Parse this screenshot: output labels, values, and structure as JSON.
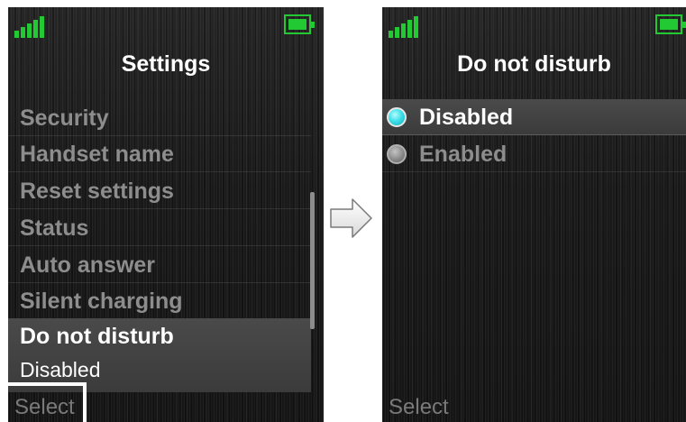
{
  "colors": {
    "signal": "#22c932",
    "battery": "#22c932",
    "radio_selected": "#3fe1ea"
  },
  "left_screen": {
    "status": {
      "signal_icon": "signal-bars-icon",
      "battery_icon": "battery-full-icon"
    },
    "title": "Settings",
    "menu": [
      {
        "label": "Security"
      },
      {
        "label": "Handset name"
      },
      {
        "label": "Reset settings"
      },
      {
        "label": "Status"
      },
      {
        "label": "Auto answer"
      },
      {
        "label": "Silent charging"
      },
      {
        "label": "Do not disturb",
        "value": "Disabled",
        "selected": true
      }
    ],
    "softkey": "Select"
  },
  "transition_icon": "right-arrow-icon",
  "right_screen": {
    "status": {
      "signal_icon": "signal-bars-icon",
      "battery_icon": "battery-full-icon"
    },
    "title": "Do not disturb",
    "options": [
      {
        "label": "Disabled",
        "selected": true
      },
      {
        "label": "Enabled",
        "selected": false
      }
    ],
    "softkey": "Select"
  }
}
